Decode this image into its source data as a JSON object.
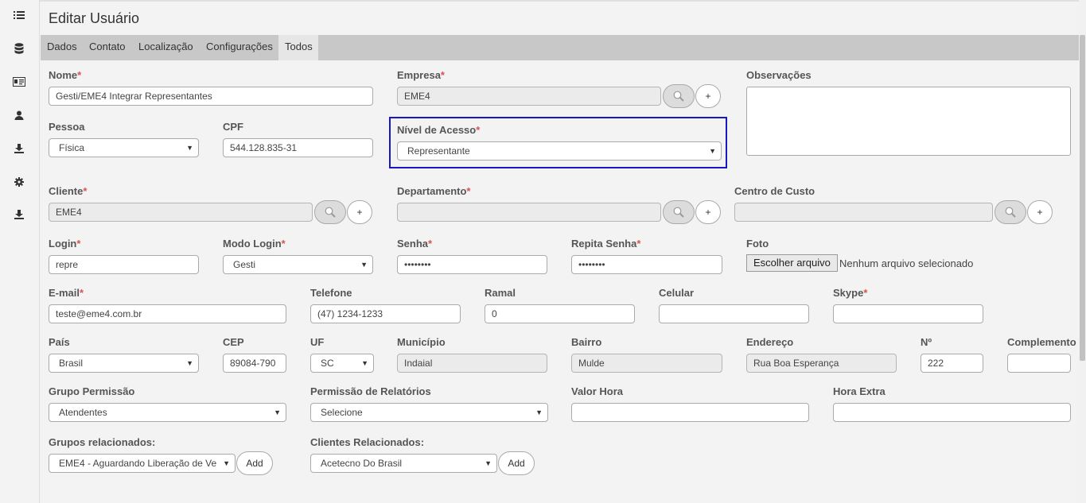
{
  "page": {
    "title": "Editar Usuário",
    "tabs": [
      "Dados",
      "Contato",
      "Localização",
      "Configurações",
      "Todos"
    ],
    "active_tab": "Todos"
  },
  "sidebar": {
    "icons": [
      "list-icon",
      "database-icon",
      "id-card-icon",
      "user-icon",
      "download-icon",
      "gear-icon",
      "download-icon"
    ]
  },
  "form": {
    "nome": {
      "label": "Nome",
      "value": "Gesti/EME4 Integrar Representantes"
    },
    "empresa": {
      "label": "Empresa",
      "value": "EME4"
    },
    "observacoes": {
      "label": "Observações",
      "value": ""
    },
    "pessoa": {
      "label": "Pessoa",
      "value": "Física"
    },
    "cpf": {
      "label": "CPF",
      "value": "544.128.835-31"
    },
    "nivel_acesso": {
      "label": "Nível de Acesso",
      "value": "Representante"
    },
    "cliente": {
      "label": "Cliente",
      "value": "EME4"
    },
    "departamento": {
      "label": "Departamento",
      "value": ""
    },
    "centro_custo": {
      "label": "Centro de Custo",
      "value": ""
    },
    "login": {
      "label": "Login",
      "value": "repre"
    },
    "modo_login": {
      "label": "Modo Login",
      "value": "Gesti"
    },
    "senha": {
      "label": "Senha",
      "value": "••••••••"
    },
    "repita_senha": {
      "label": "Repita Senha",
      "value": "••••••••"
    },
    "foto": {
      "label": "Foto",
      "button": "Escolher arquivo",
      "status": "Nenhum arquivo selecionado"
    },
    "email": {
      "label": "E-mail",
      "value": "teste@eme4.com.br"
    },
    "telefone": {
      "label": "Telefone",
      "value": "(47) 1234-1233"
    },
    "ramal": {
      "label": "Ramal",
      "value": "0"
    },
    "celular": {
      "label": "Celular",
      "value": ""
    },
    "skype": {
      "label": "Skype",
      "value": ""
    },
    "pais": {
      "label": "País",
      "value": "Brasil"
    },
    "cep": {
      "label": "CEP",
      "value": "89084-790"
    },
    "uf": {
      "label": "UF",
      "value": "SC"
    },
    "municipio": {
      "label": "Município",
      "value": "Indaial"
    },
    "bairro": {
      "label": "Bairro",
      "value": "Mulde"
    },
    "endereco": {
      "label": "Endereço",
      "value": "Rua Boa Esperança"
    },
    "numero": {
      "label": "Nº",
      "value": "222"
    },
    "complemento": {
      "label": "Complemento",
      "value": ""
    },
    "grupo_permissao": {
      "label": "Grupo Permissão",
      "value": "Atendentes"
    },
    "permissao_relatorios": {
      "label": "Permissão de Relatórios",
      "value": "Selecione"
    },
    "valor_hora": {
      "label": "Valor Hora",
      "value": ""
    },
    "hora_extra": {
      "label": "Hora Extra",
      "value": ""
    },
    "grupos_relacionados": {
      "label": "Grupos relacionados:",
      "value": "EME4 - Aguardando Liberação de Ve"
    },
    "clientes_relacionados": {
      "label": "Clientes Relacionados:",
      "value": "Acetecno Do Brasil"
    }
  },
  "buttons": {
    "plus": "+",
    "add": "Add"
  },
  "required_mark": "*",
  "colors": {
    "highlight": "#1717c4",
    "required": "#d9534f",
    "tabbar": "#c8c8c8"
  }
}
